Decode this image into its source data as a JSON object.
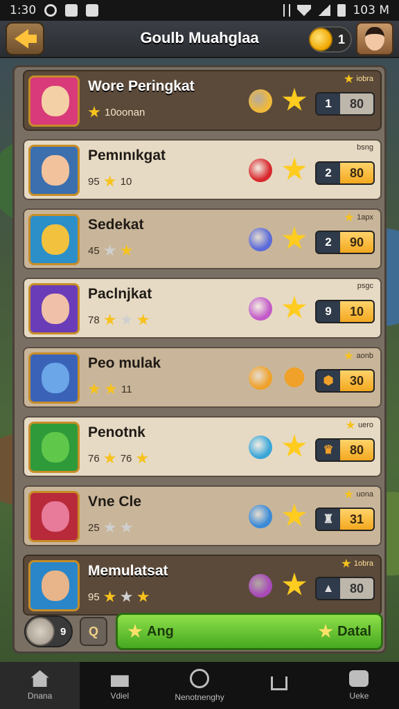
{
  "status_bar": {
    "time": "1:30",
    "right_text": "103 M"
  },
  "header": {
    "title": "Goulb Muahglaa",
    "coins": "1"
  },
  "rows": [
    {
      "name": "Wore Peringkat",
      "sub": "10oonan",
      "tag": "iobra",
      "rank": "1",
      "score": "80",
      "style": "dark",
      "portrait_color": "#d83a7a",
      "face_color": "#f4d0a6",
      "item_color": "#f0b93a"
    },
    {
      "name": "Pemınıkgat",
      "sub_left": "95",
      "sub_right": "10",
      "tag": "bsng",
      "rank": "2",
      "score": "80",
      "style": "light",
      "portrait_color": "#3b6fae",
      "face_color": "#f2c29c",
      "item_color": "#d8282c"
    },
    {
      "name": "Sedekat",
      "sub_left": "45",
      "tag": "1apx",
      "rank": "2",
      "score": "90",
      "style": "mid",
      "portrait_color": "#2c8fc8",
      "face_color": "#f2c13d",
      "item_color": "#5a6ad8"
    },
    {
      "name": "Paclnjkat",
      "sub_left": "78",
      "tag": "psgc",
      "rank": "9",
      "score": "10",
      "style": "light",
      "portrait_color": "#6a3cb8",
      "face_color": "#f0c0a8",
      "item_color": "#c25ac8"
    },
    {
      "name": "Peo mulak",
      "sub_left": "",
      "sub_right": "11",
      "tag": "aonb",
      "rank": "",
      "score": "30",
      "style": "mid",
      "portrait_color": "#3a63b8",
      "face_color": "#6aa6e8",
      "item_color": "#f0a12a"
    },
    {
      "name": "Penotnk",
      "sub_left": "76",
      "sub_right": "76",
      "tag": "uero",
      "rank": "",
      "score": "80",
      "style": "light",
      "portrait_color": "#2e9a3a",
      "face_color": "#5fc84a",
      "item_color": "#3aa6d8"
    },
    {
      "name": "Vne Cle",
      "sub_left": "25",
      "tag": "uona",
      "rank": "",
      "score": "31",
      "style": "mid",
      "portrait_color": "#b82a3a",
      "face_color": "#e87a9a",
      "item_color": "#3a8ad8"
    },
    {
      "name": "Memulatsat",
      "sub_left": "95",
      "tag": "1obra",
      "rank": "",
      "score": "80",
      "style": "dark",
      "portrait_color": "#2a86c8",
      "face_color": "#e8b48a",
      "item_color": "#a84ab8"
    }
  ],
  "bottom_actions": {
    "left_count": "9",
    "info_label": "Q",
    "action_left": "Ang",
    "action_right": "Datal"
  },
  "nav": [
    {
      "label": "Dnana",
      "icon": "home-icon"
    },
    {
      "label": "Vdiel",
      "icon": "shop-icon"
    },
    {
      "label": "Nenotnenghy",
      "icon": "circle-icon"
    },
    {
      "label": "",
      "icon": "house-outline-icon"
    },
    {
      "label": "Ueke",
      "icon": "chat-icon"
    }
  ]
}
